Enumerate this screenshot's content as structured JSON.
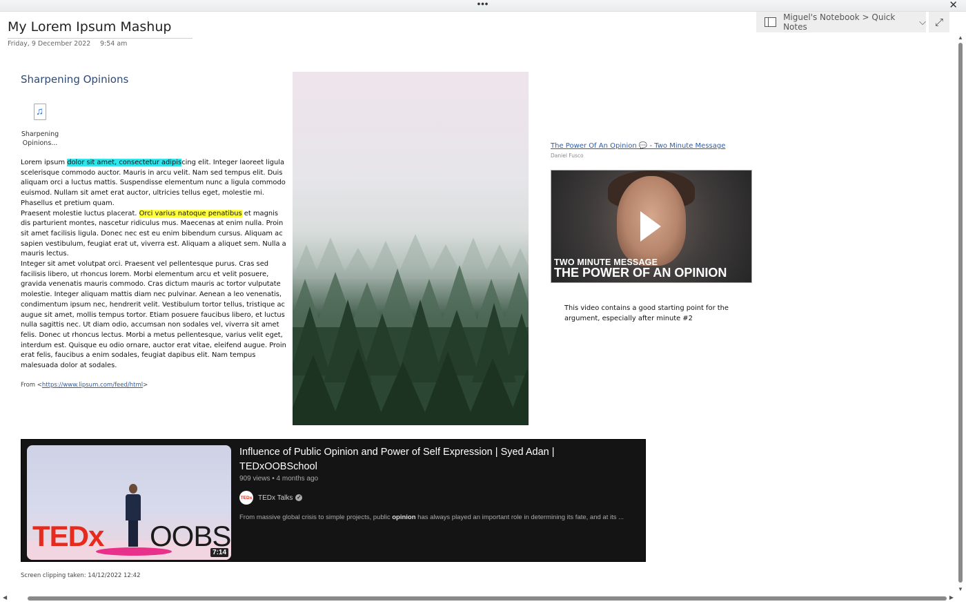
{
  "window": {
    "menu_dots": "•••",
    "close_glyph": "✕"
  },
  "header": {
    "notebook_path": "Miguel's Notebook > Quick Notes",
    "chevron": "⌵",
    "expand_glyph": "⤢"
  },
  "page": {
    "title": "My Lorem Ipsum Mashup",
    "date": "Friday, 9 December 2022",
    "time": "9:54 am"
  },
  "section": {
    "heading": "Sharpening Opinions",
    "attachment_name": "Sharpening Opinions...",
    "attachment_icon": "audio-file-icon"
  },
  "body": {
    "p1_before": "Lorem ipsum ",
    "p1_highlight": "dolor sit amet, consectetur adipis",
    "p1_after": "cing elit. Integer laoreet ligula scelerisque commodo auctor. Mauris in arcu velit. Nam sed tempus elit. Duis aliquam orci a luctus mattis. Suspendisse elementum nunc a ligula commodo euismod. Nullam sit amet erat auctor, ultricies tellus eget, molestie mi. Phasellus et pretium quam.",
    "p2_before": "Praesent molestie luctus placerat. ",
    "p2_highlight": "Orci varius natoque penatibus",
    "p2_after": " et magnis dis parturient montes, nascetur ridiculus mus. Maecenas at enim nulla. Proin sit amet facilisis ligula. Donec nec est eu enim bibendum cursus. Aliquam ac sapien vestibulum, feugiat erat ut, viverra est. Aliquam a aliquet sem. Nulla a mauris lectus.",
    "p3": "Integer sit amet volutpat orci. Praesent vel pellentesque purus. Cras sed facilisis libero, ut rhoncus lorem. Morbi elementum arcu et velit posuere, gravida venenatis mauris commodo. Cras dictum mauris ac tortor vulputate molestie. Integer aliquam mattis diam nec pulvinar. Aenean a leo venenatis, condimentum ipsum nec, hendrerit velit. Vestibulum tortor tellus, tristique ac augue sit amet, mollis tempus tortor. Etiam posuere faucibus libero, et luctus nulla sagittis nec. Ut diam odio, accumsan non sodales vel, viverra sit amet felis. Donec ut rhoncus lectus. Morbi a metus pellentesque, varius velit eget, interdum est. Quisque eu odio ornare, auctor erat vitae, eleifend augue. Proin erat felis, faucibus a enim sodales, feugiat dapibus elit. Nam tempus malesuada dolor at sodales.",
    "from_prefix": "From <",
    "from_link": "https://www.lipsum.com/feed/html",
    "from_suffix": ">",
    "highlight_colors": {
      "cyan": "#2fe4ea",
      "yellow": "#ffff40"
    }
  },
  "video_embed": {
    "link_text": "The Power Of An Opinion 💬  - Two Minute Message",
    "author": "Daniel Fusco",
    "caption_line1": "TWO MINUTE MESSAGE",
    "caption_line2": "THE POWER OF AN OPINION",
    "note": "This video contains a good starting point for the argument, especially after minute #2"
  },
  "youtube_card": {
    "title": "Influence of Public Opinion and Power of Self Expression | Syed Adan | TEDxOOBSchool",
    "meta": "909 views • 4 months ago",
    "channel": "TEDx Talks",
    "avatar_text": "TEDx",
    "duration": "7:14",
    "thumb_text_red": "TEDx",
    "thumb_text_dark": "OOBSc",
    "desc_before": "From massive global crisis to simple projects, public ",
    "desc_bold": "opinion",
    "desc_after": " has always played an important role in determining its fate, and at its ..."
  },
  "footer": {
    "clip_note": "Screen clipping taken: 14/12/2022 12:42"
  },
  "scrollbars": {
    "up": "▲",
    "down": "▼",
    "left": "◀",
    "right": "▶"
  }
}
